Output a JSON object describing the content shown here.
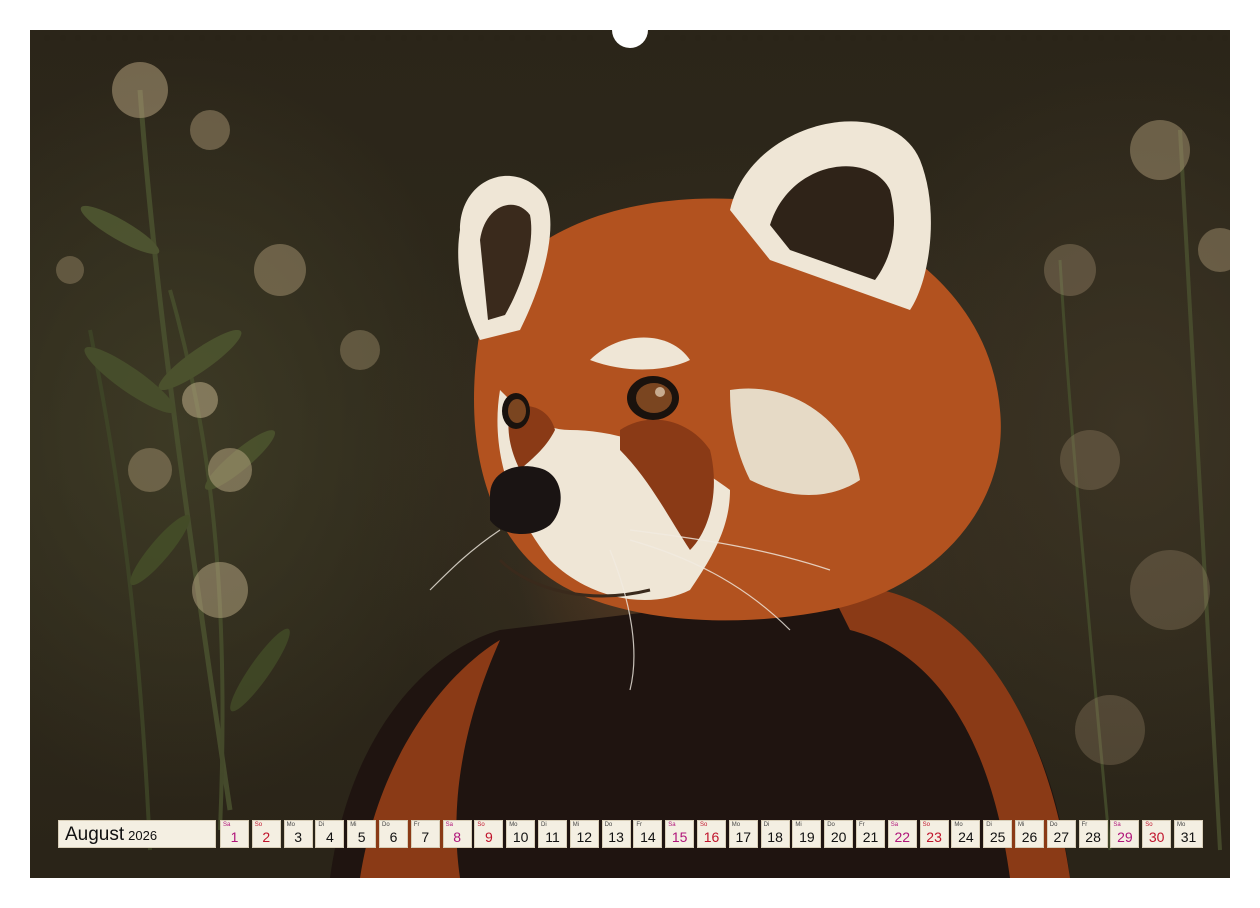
{
  "calendar": {
    "month": "August",
    "year": "2026",
    "days": [
      {
        "wd": "Sa",
        "n": "1",
        "type": "sat"
      },
      {
        "wd": "So",
        "n": "2",
        "type": "sun"
      },
      {
        "wd": "Mo",
        "n": "3",
        "type": "wk"
      },
      {
        "wd": "Di",
        "n": "4",
        "type": "wk"
      },
      {
        "wd": "Mi",
        "n": "5",
        "type": "wk"
      },
      {
        "wd": "Do",
        "n": "6",
        "type": "wk"
      },
      {
        "wd": "Fr",
        "n": "7",
        "type": "wk"
      },
      {
        "wd": "Sa",
        "n": "8",
        "type": "sat"
      },
      {
        "wd": "So",
        "n": "9",
        "type": "sun"
      },
      {
        "wd": "Mo",
        "n": "10",
        "type": "wk"
      },
      {
        "wd": "Di",
        "n": "11",
        "type": "wk"
      },
      {
        "wd": "Mi",
        "n": "12",
        "type": "wk"
      },
      {
        "wd": "Do",
        "n": "13",
        "type": "wk"
      },
      {
        "wd": "Fr",
        "n": "14",
        "type": "wk"
      },
      {
        "wd": "Sa",
        "n": "15",
        "type": "sat"
      },
      {
        "wd": "So",
        "n": "16",
        "type": "sun"
      },
      {
        "wd": "Mo",
        "n": "17",
        "type": "wk"
      },
      {
        "wd": "Di",
        "n": "18",
        "type": "wk"
      },
      {
        "wd": "Mi",
        "n": "19",
        "type": "wk"
      },
      {
        "wd": "Do",
        "n": "20",
        "type": "wk"
      },
      {
        "wd": "Fr",
        "n": "21",
        "type": "wk"
      },
      {
        "wd": "Sa",
        "n": "22",
        "type": "sat"
      },
      {
        "wd": "So",
        "n": "23",
        "type": "sun"
      },
      {
        "wd": "Mo",
        "n": "24",
        "type": "wk"
      },
      {
        "wd": "Di",
        "n": "25",
        "type": "wk"
      },
      {
        "wd": "Mi",
        "n": "26",
        "type": "wk"
      },
      {
        "wd": "Do",
        "n": "27",
        "type": "wk"
      },
      {
        "wd": "Fr",
        "n": "28",
        "type": "wk"
      },
      {
        "wd": "Sa",
        "n": "29",
        "type": "sat"
      },
      {
        "wd": "So",
        "n": "30",
        "type": "sun"
      },
      {
        "wd": "Mo",
        "n": "31",
        "type": "wk"
      }
    ]
  },
  "photo": {
    "subject": "red-panda-icon",
    "colors": {
      "fur": "#b2521f",
      "fur_dark": "#6e2c12",
      "white": "#efe6d6",
      "background": "#2d271b",
      "foliage": "#4b5230",
      "flowers": "#c9b38c"
    }
  }
}
